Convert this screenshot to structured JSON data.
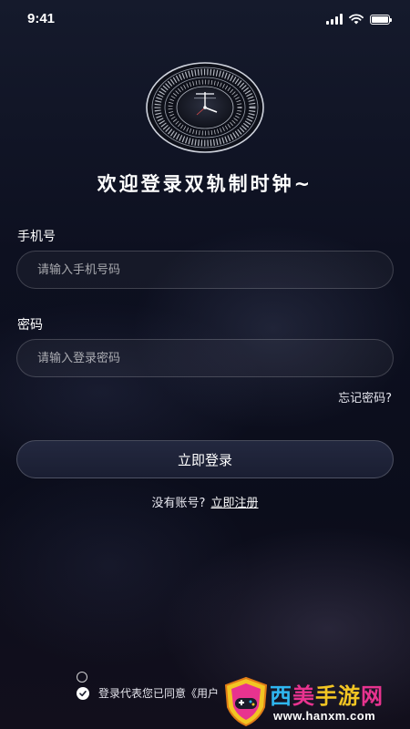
{
  "status_bar": {
    "time": "9:41"
  },
  "login": {
    "welcome_title": "欢迎登录双轨制时钟~",
    "phone_label": "手机号",
    "phone_placeholder": "请输入手机号码",
    "password_label": "密码",
    "password_placeholder": "请输入登录密码",
    "forgot_password": "忘记密码?",
    "submit_label": "立即登录",
    "no_account_text": "没有账号?",
    "register_link": "立即注册",
    "agreement_text": "登录代表您已同意《用户"
  },
  "watermark": {
    "title_1": "西",
    "title_2": "美",
    "title_3": "手",
    "title_4": "游",
    "title_5": "网",
    "url": "www.hanxm.com"
  },
  "colors": {
    "background": "#0b0d1a",
    "button": "#1f2438",
    "watermark_cyan": "#2fb6f0",
    "watermark_pink": "#e8338f",
    "watermark_yellow": "#f2c523"
  }
}
